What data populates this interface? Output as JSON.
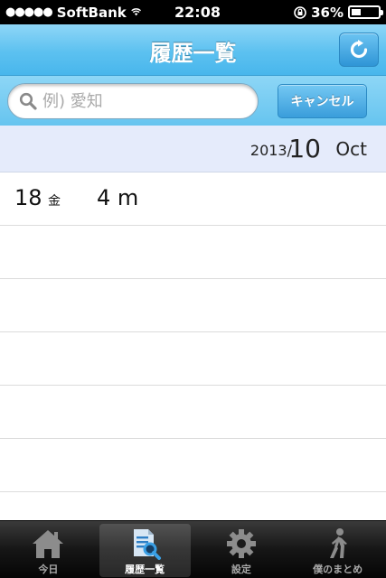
{
  "status_bar": {
    "carrier": "SoftBank",
    "time": "22:08",
    "battery_percent": "36%",
    "battery_level": 0.36
  },
  "nav": {
    "title": "履歴一覧",
    "refresh_icon": "refresh-icon"
  },
  "search": {
    "placeholder": "例) 愛知",
    "value": "",
    "cancel_label": "キャンセル"
  },
  "month_header": {
    "year": "2013/",
    "month": "10",
    "month_name": "Oct"
  },
  "entries": [
    {
      "day": "18",
      "weekday": "金",
      "duration": "4 m"
    }
  ],
  "tabs": [
    {
      "label": "今日",
      "icon": "home-icon",
      "selected": false
    },
    {
      "label": "履歴一覧",
      "icon": "history-list-icon",
      "selected": true
    },
    {
      "label": "設定",
      "icon": "gear-icon",
      "selected": false
    },
    {
      "label": "僕のまとめ",
      "icon": "walking-person-icon",
      "selected": false
    }
  ],
  "colors": {
    "nav_blue": "#5cc1f0",
    "month_header_bg": "#e5ebfb",
    "tab_bar_bg": "#161616"
  }
}
